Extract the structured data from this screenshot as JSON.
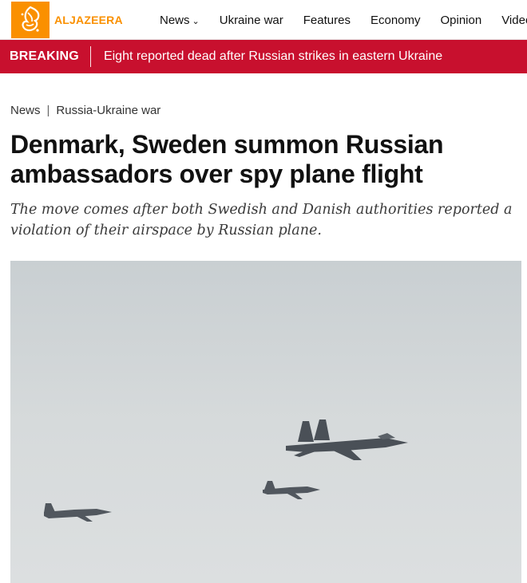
{
  "brand": {
    "name": "ALJAZEERA",
    "color": "#fa9000"
  },
  "nav": {
    "items": [
      {
        "label": "News",
        "has_dropdown": true
      },
      {
        "label": "Ukraine war"
      },
      {
        "label": "Features"
      },
      {
        "label": "Economy"
      },
      {
        "label": "Opinion"
      },
      {
        "label": "Video"
      }
    ]
  },
  "breaking": {
    "label": "BREAKING",
    "text": "Eight reported dead after Russian strikes in eastern Ukraine",
    "color": "#c8102e"
  },
  "article": {
    "breadcrumb": [
      "News",
      "Russia-Ukraine war"
    ],
    "headline": "Denmark, Sweden summon Russian ambassadors over spy plane flight",
    "dek": "The move comes after both Swedish and Danish authorities reported a violation of their airspace by Russian plane."
  }
}
